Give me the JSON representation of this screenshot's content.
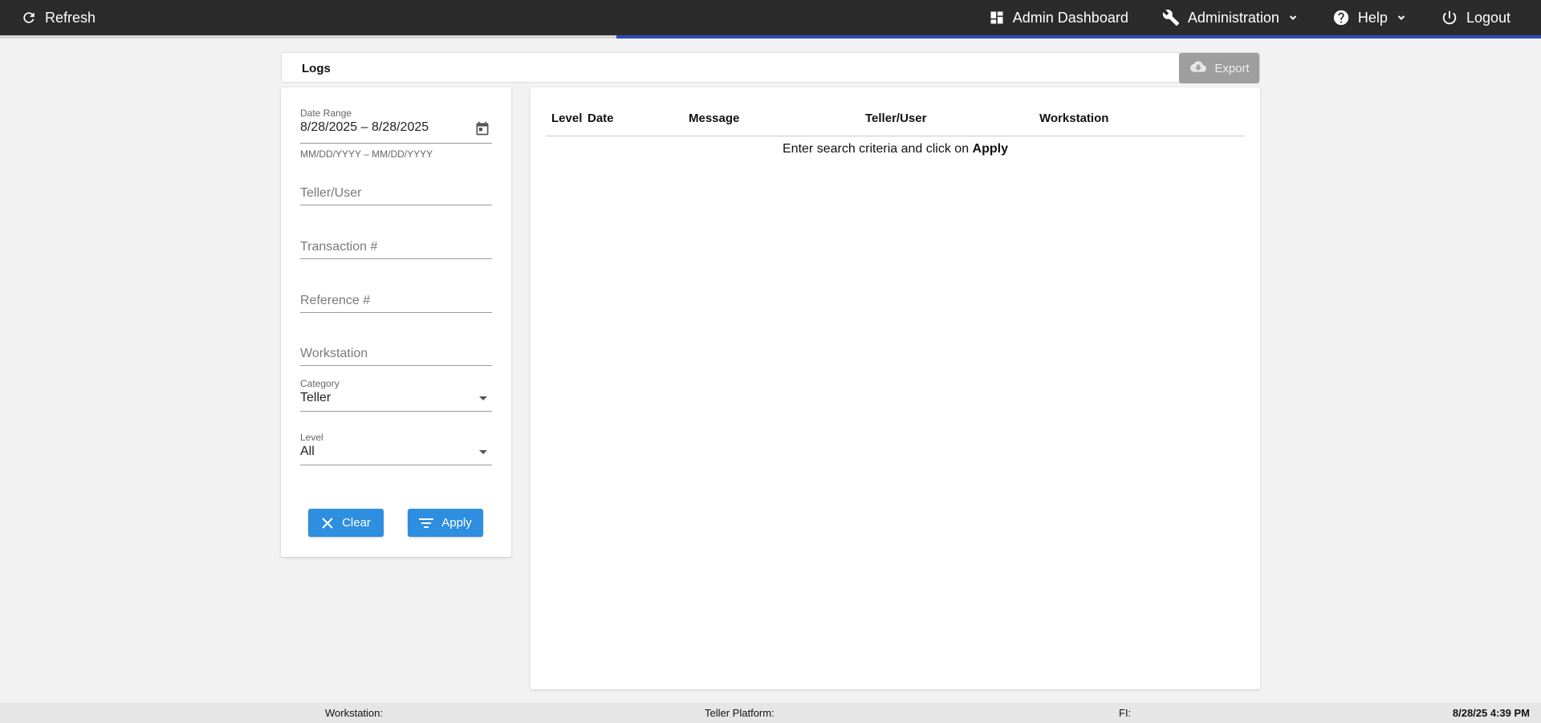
{
  "topbar": {
    "refresh_label": "Refresh",
    "admin_dashboard_label": "Admin Dashboard",
    "administration_label": "Administration",
    "help_label": "Help",
    "logout_label": "Logout",
    "accent_color": "#2f4bb8"
  },
  "header": {
    "title": "Logs",
    "export_label": "Export"
  },
  "filters": {
    "date_range": {
      "label": "Date Range",
      "value": "8/28/2025 – 8/28/2025",
      "hint": "MM/DD/YYYY – MM/DD/YYYY"
    },
    "teller_user": {
      "placeholder": "Teller/User"
    },
    "transaction": {
      "placeholder": "Transaction #"
    },
    "reference": {
      "placeholder": "Reference #"
    },
    "workstation": {
      "placeholder": "Workstation"
    },
    "category": {
      "label": "Category",
      "value": "Teller"
    },
    "level": {
      "label": "Level",
      "value": "All"
    },
    "clear_label": "Clear",
    "apply_label": "Apply",
    "button_color": "#2e8ee0"
  },
  "table": {
    "columns": [
      "Level",
      "Date",
      "Message",
      "Teller/User",
      "Workstation"
    ],
    "empty_message_prefix": "Enter search criteria and click on ",
    "empty_message_action": "Apply"
  },
  "footer": {
    "workstation_label": "Workstation:",
    "teller_platform_label": "Teller Platform:",
    "fi_label": "FI:",
    "datetime": "8/28/25 4:39 PM"
  },
  "icons": {
    "refresh": "refresh-icon",
    "dashboard": "dashboard-icon",
    "administration": "wrench-icon",
    "help": "help-circle-icon",
    "logout": "power-icon",
    "export": "cloud-download-icon",
    "calendar": "calendar-icon",
    "clear": "close-icon",
    "apply": "filter-icon"
  }
}
